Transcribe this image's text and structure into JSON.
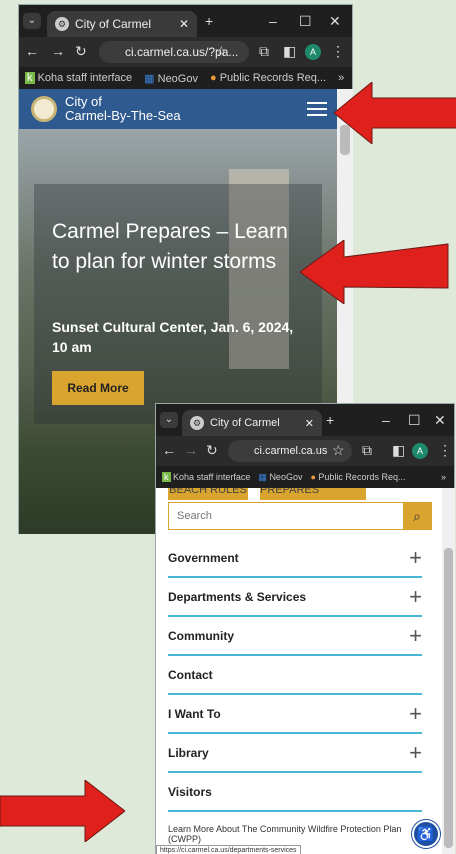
{
  "window1": {
    "tab_title": "City of Carmel",
    "url": "ci.carmel.ca.us/?pa...",
    "bookmarks": [
      "Koha staff interface",
      "NeoGov",
      "Public Records Req..."
    ],
    "site_name_line1": "City of",
    "site_name_line2": "Carmel-By-The-Sea",
    "hero_title": "Carmel Prepares – Learn to plan for winter storms",
    "hero_subtitle": "Sunset Cultural Center, Jan. 6, 2024, 10 am",
    "read_more": "Read More"
  },
  "window2": {
    "tab_title": "City of Carmel",
    "url": "ci.carmel.ca.us",
    "bookmarks": [
      "Koha staff interface",
      "NeoGov",
      "Public Records Req..."
    ],
    "top_buttons": [
      "BEACH RULES",
      "CARMEL PREPARES"
    ],
    "search_placeholder": "Search",
    "menu": [
      {
        "label": "Government",
        "expandable": true
      },
      {
        "label": "Departments & Services",
        "expandable": true
      },
      {
        "label": "Community",
        "expandable": true
      },
      {
        "label": "Contact",
        "expandable": false
      },
      {
        "label": "I Want To",
        "expandable": true
      },
      {
        "label": "Library",
        "expandable": true
      },
      {
        "label": "Visitors",
        "expandable": false
      }
    ],
    "cwpp_link": "Learn More About The Community Wildfire Protection Plan (CWPP)",
    "status_url": "https://ci.carmel.ca.us/departments-services"
  },
  "avatar_letter": "A",
  "colors": {
    "header_blue": "#2e5a8f",
    "gold": "#d9a52e",
    "red_arrow": "#e0201c",
    "divider": "#49b8d6"
  }
}
